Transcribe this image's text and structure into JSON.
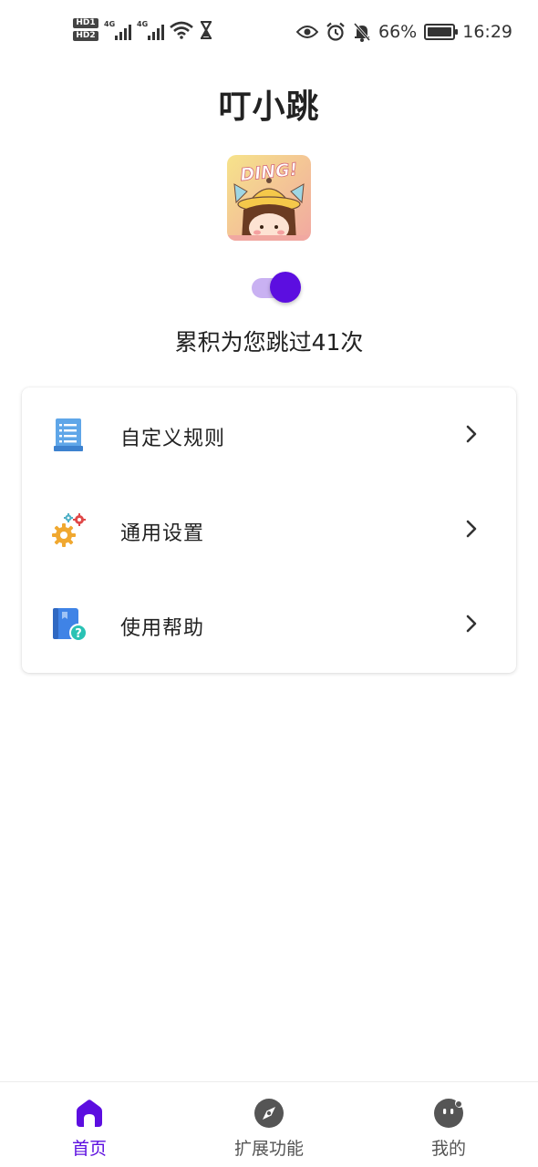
{
  "status_bar": {
    "hd1": "HD1",
    "hd2": "HD2",
    "sim1_network": "4G",
    "sim2_network": "4G",
    "battery_percent": "66%",
    "time": "16:29",
    "icons": [
      "wifi-icon",
      "hourglass-icon",
      "eye-icon",
      "alarm-icon",
      "bell-off-icon",
      "battery-icon"
    ]
  },
  "header": {
    "title": "叮小跳"
  },
  "logo": {
    "text": "DING!"
  },
  "service_toggle": {
    "state": "on",
    "accent": "#5c0ee0"
  },
  "stats": {
    "skip_text": "累积为您跳过41次",
    "skip_count": 41
  },
  "menu": {
    "items": [
      {
        "label": "自定义规则",
        "icon": "document-list-icon"
      },
      {
        "label": "通用设置",
        "icon": "gears-icon"
      },
      {
        "label": "使用帮助",
        "icon": "help-book-icon"
      }
    ]
  },
  "bottom_nav": {
    "items": [
      {
        "label": "首页",
        "icon": "home-icon",
        "active": true
      },
      {
        "label": "扩展功能",
        "icon": "compass-icon",
        "active": false
      },
      {
        "label": "我的",
        "icon": "profile-face-icon",
        "active": false
      }
    ]
  },
  "colors": {
    "accent": "#5c0ee0",
    "toggle_track": "#c9b1f2",
    "text": "#222222",
    "inactive_nav": "#555555"
  }
}
